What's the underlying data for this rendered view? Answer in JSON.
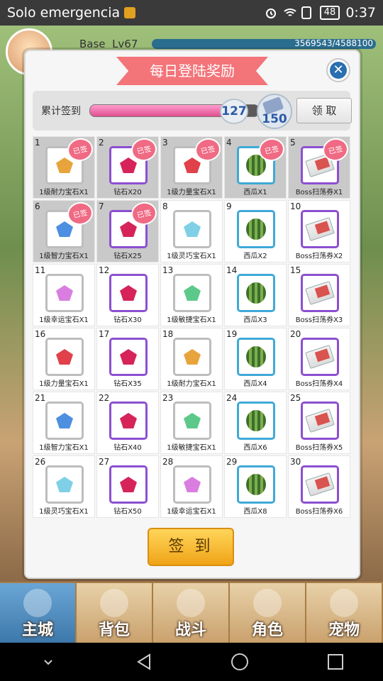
{
  "status_bar": {
    "carrier": "Solo emergencia",
    "battery": "48",
    "time": "0:37"
  },
  "player": {
    "level_label": "Base",
    "level": "Lv67",
    "exp": "3569543/4588100"
  },
  "modal": {
    "title": "每日登陆奖励",
    "close_icon": "close-icon",
    "progress": {
      "label": "累计签到",
      "current": "127",
      "goal": "150",
      "fraction": 0.8467
    },
    "claim_label": "领 取",
    "sign_in_label": "签 到",
    "signed_stamp": "已签",
    "rewards": [
      {
        "day": "1",
        "label": "1级耐力宝石X1",
        "kind": "gem",
        "color": "#e8a43c",
        "frame": "gray",
        "signed": true
      },
      {
        "day": "2",
        "label": "钻石X20",
        "kind": "gem",
        "color": "#d6245a",
        "frame": "purple",
        "signed": true
      },
      {
        "day": "3",
        "label": "1级力量宝石X1",
        "kind": "gem",
        "color": "#e0414a",
        "frame": "gray",
        "signed": true
      },
      {
        "day": "4",
        "label": "西瓜X1",
        "kind": "melon",
        "color": "#4c8a36",
        "frame": "blue",
        "signed": true
      },
      {
        "day": "5",
        "label": "Boss扫荡券X1",
        "kind": "ticket",
        "color": "#d9534f",
        "frame": "purple",
        "signed": true
      },
      {
        "day": "6",
        "label": "1级智力宝石X1",
        "kind": "gem",
        "color": "#4d8fe0",
        "frame": "gray",
        "signed": true
      },
      {
        "day": "7",
        "label": "钻石X25",
        "kind": "gem",
        "color": "#d6245a",
        "frame": "purple",
        "signed": true
      },
      {
        "day": "8",
        "label": "1级灵巧宝石X1",
        "kind": "gem",
        "color": "#7fd0e6",
        "frame": "gray",
        "signed": false
      },
      {
        "day": "9",
        "label": "西瓜X2",
        "kind": "melon",
        "color": "#4c8a36",
        "frame": "blue",
        "signed": false
      },
      {
        "day": "10",
        "label": "Boss扫荡券X2",
        "kind": "ticket",
        "color": "#d9534f",
        "frame": "purple",
        "signed": false
      },
      {
        "day": "11",
        "label": "1级幸运宝石X1",
        "kind": "gem",
        "color": "#d97ee0",
        "frame": "gray",
        "signed": false
      },
      {
        "day": "12",
        "label": "钻石X30",
        "kind": "gem",
        "color": "#d6245a",
        "frame": "purple",
        "signed": false
      },
      {
        "day": "13",
        "label": "1级敏捷宝石X1",
        "kind": "gem",
        "color": "#5cc98a",
        "frame": "gray",
        "signed": false
      },
      {
        "day": "14",
        "label": "西瓜X3",
        "kind": "melon",
        "color": "#4c8a36",
        "frame": "blue",
        "signed": false
      },
      {
        "day": "15",
        "label": "Boss扫荡券X3",
        "kind": "ticket",
        "color": "#d9534f",
        "frame": "purple",
        "signed": false
      },
      {
        "day": "16",
        "label": "1级力量宝石X1",
        "kind": "gem",
        "color": "#e0414a",
        "frame": "gray",
        "signed": false
      },
      {
        "day": "17",
        "label": "钻石X35",
        "kind": "gem",
        "color": "#d6245a",
        "frame": "purple",
        "signed": false
      },
      {
        "day": "18",
        "label": "1级耐力宝石X1",
        "kind": "gem",
        "color": "#e8a43c",
        "frame": "gray",
        "signed": false
      },
      {
        "day": "19",
        "label": "西瓜X4",
        "kind": "melon",
        "color": "#4c8a36",
        "frame": "blue",
        "signed": false
      },
      {
        "day": "20",
        "label": "Boss扫荡券X4",
        "kind": "ticket",
        "color": "#d9534f",
        "frame": "purple",
        "signed": false
      },
      {
        "day": "21",
        "label": "1级智力宝石X1",
        "kind": "gem",
        "color": "#4d8fe0",
        "frame": "gray",
        "signed": false
      },
      {
        "day": "22",
        "label": "钻石X40",
        "kind": "gem",
        "color": "#d6245a",
        "frame": "purple",
        "signed": false
      },
      {
        "day": "23",
        "label": "1级敏捷宝石X1",
        "kind": "gem",
        "color": "#5cc98a",
        "frame": "gray",
        "signed": false
      },
      {
        "day": "24",
        "label": "西瓜X6",
        "kind": "melon",
        "color": "#4c8a36",
        "frame": "blue",
        "signed": false
      },
      {
        "day": "25",
        "label": "Boss扫荡券X5",
        "kind": "ticket",
        "color": "#d9534f",
        "frame": "purple",
        "signed": false
      },
      {
        "day": "26",
        "label": "1级灵巧宝石X1",
        "kind": "gem",
        "color": "#7fd0e6",
        "frame": "gray",
        "signed": false
      },
      {
        "day": "27",
        "label": "钻石X50",
        "kind": "gem",
        "color": "#d6245a",
        "frame": "purple",
        "signed": false
      },
      {
        "day": "28",
        "label": "1级幸运宝石X1",
        "kind": "gem",
        "color": "#d97ee0",
        "frame": "gray",
        "signed": false
      },
      {
        "day": "29",
        "label": "西瓜X8",
        "kind": "melon",
        "color": "#4c8a36",
        "frame": "blue",
        "signed": false
      },
      {
        "day": "30",
        "label": "Boss扫荡券X6",
        "kind": "ticket",
        "color": "#d9534f",
        "frame": "purple",
        "signed": false
      }
    ]
  },
  "bottom_nav": [
    {
      "label": "主城",
      "icon": "castle-icon",
      "active": true
    },
    {
      "label": "背包",
      "icon": "backpack-icon",
      "active": false
    },
    {
      "label": "战斗",
      "icon": "crossed-swords-icon",
      "active": false
    },
    {
      "label": "角色",
      "icon": "character-icon",
      "active": false
    },
    {
      "label": "宠物",
      "icon": "pet-icon",
      "active": false
    }
  ],
  "android_nav": [
    "back-icon",
    "home-icon",
    "recents-icon"
  ]
}
